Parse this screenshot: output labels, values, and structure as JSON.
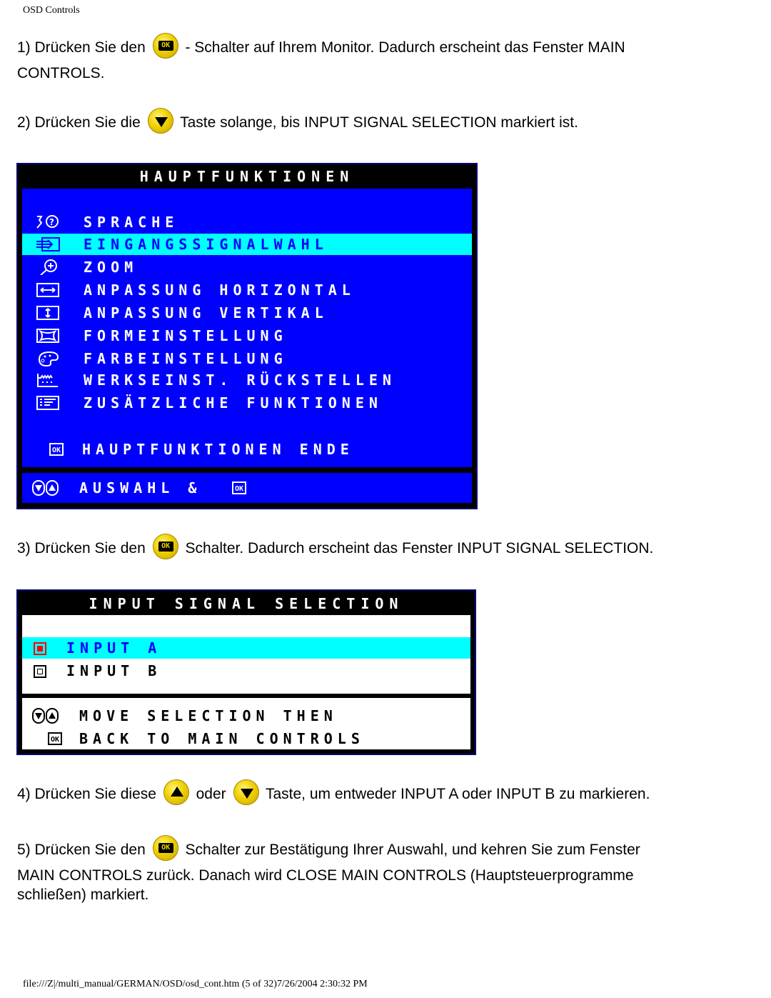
{
  "header": {
    "title": "OSD Controls"
  },
  "steps": {
    "s1": {
      "prefix": "1) Drücken Sie den",
      "suffix": "- Schalter auf Ihrem Monitor. Dadurch erscheint das Fenster MAIN",
      "line2": "CONTROLS.",
      "icon": "ok-button-icon"
    },
    "s2": {
      "prefix": "2) Drücken Sie die",
      "suffix": "Taste solange, bis INPUT SIGNAL SELECTION markiert ist.",
      "icon": "down-button-icon"
    },
    "s3": {
      "prefix": "3) Drücken Sie den",
      "suffix": "Schalter. Dadurch erscheint das Fenster INPUT SIGNAL SELECTION.",
      "icon": "ok-button-icon"
    },
    "s4": {
      "prefix": "4) Drücken Sie diese",
      "middle": "oder",
      "suffix": "Taste, um entweder INPUT A oder INPUT B zu markieren.",
      "icons": [
        "up-button-icon",
        "down-button-icon"
      ]
    },
    "s5": {
      "prefix": "5) Drücken Sie den",
      "suffix": "Schalter zur Bestätigung Ihrer Auswahl, und kehren Sie zum Fenster",
      "line2": "MAIN CONTROLS zurück. Danach wird CLOSE MAIN CONTROLS (Hauptsteuerprogramme",
      "line3": "schließen) markiert.",
      "icon": "ok-button-icon"
    }
  },
  "ok_glyph": "OK",
  "osd_main": {
    "title": "HAUPTFUNKTIONEN",
    "items": [
      {
        "label": "SPRACHE",
        "icon": "language-icon",
        "selected": false
      },
      {
        "label": "EINGANGSSIGNALWAHL",
        "icon": "input-signal-icon",
        "selected": true
      },
      {
        "label": "ZOOM",
        "icon": "zoom-icon",
        "selected": false
      },
      {
        "label": "ANPASSUNG HORIZONTAL",
        "icon": "horizontal-adjust-icon",
        "selected": false
      },
      {
        "label": "ANPASSUNG VERTIKAL",
        "icon": "vertical-adjust-icon",
        "selected": false
      },
      {
        "label": "FORMEINSTELLUNG",
        "icon": "shape-icon",
        "selected": false
      },
      {
        "label": "FARBEINSTELLUNG",
        "icon": "color-palette-icon",
        "selected": false
      },
      {
        "label": "WERKSEINST. RÜCKSTELLEN",
        "icon": "factory-reset-icon",
        "selected": false
      },
      {
        "label": "ZUSÄTZLICHE FUNKTIONEN",
        "icon": "extra-functions-icon",
        "selected": false
      }
    ],
    "exit_label": "HAUPTFUNKTIONEN ENDE",
    "footer_label": "AUSWAHL &",
    "colors": {
      "background": "#0000ff",
      "highlight": "#00ffff",
      "text": "#ffffff",
      "frame": "#000000"
    }
  },
  "osd_input": {
    "title": "INPUT SIGNAL SELECTION",
    "options": [
      {
        "label": "INPUT A",
        "selected": true
      },
      {
        "label": "INPUT B",
        "selected": false
      }
    ],
    "footer_line1": "MOVE SELECTION THEN",
    "footer_line2": "BACK TO MAIN CONTROLS",
    "colors": {
      "background": "#ffffff",
      "highlight": "#00ffff",
      "selected_text": "#0000ff",
      "radio_on": "#ff0000"
    }
  },
  "footer": {
    "text": "file:///Z|/multi_manual/GERMAN/OSD/osd_cont.htm (5 of 32)7/26/2004 2:30:32 PM"
  }
}
